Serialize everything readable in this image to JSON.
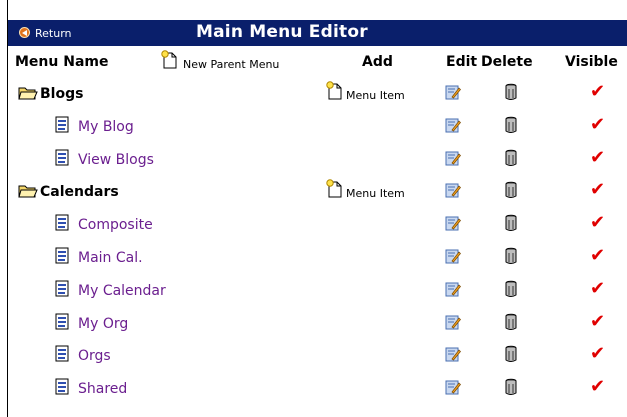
{
  "titlebar": {
    "return_label": "Return",
    "title": "Main Menu Editor"
  },
  "header": {
    "menu_name": "Menu Name",
    "new_parent": "New Parent Menu",
    "add": "Add",
    "edit": "Edit",
    "delete": "Delete",
    "visible": "Visible"
  },
  "rows": [
    {
      "name": "Blogs",
      "level": "parent",
      "add": "Menu Item",
      "visible": "✔"
    },
    {
      "name": "My Blog",
      "level": "child",
      "add": "",
      "visible": "✔"
    },
    {
      "name": "View Blogs",
      "level": "child",
      "add": "",
      "visible": "✔"
    },
    {
      "name": "Calendars",
      "level": "parent",
      "add": "Menu Item",
      "visible": "✔"
    },
    {
      "name": "Composite",
      "level": "child",
      "add": "",
      "visible": "✔"
    },
    {
      "name": "Main Cal.",
      "level": "child",
      "add": "",
      "visible": "✔"
    },
    {
      "name": "My Calendar",
      "level": "child",
      "add": "",
      "visible": "✔"
    },
    {
      "name": "My Org",
      "level": "child",
      "add": "",
      "visible": "✔"
    },
    {
      "name": "Orgs",
      "level": "child",
      "add": "",
      "visible": "✔"
    },
    {
      "name": "Shared",
      "level": "child",
      "add": "",
      "visible": "✔"
    }
  ],
  "colors": {
    "titlebar": "#0a1f6b",
    "child_link": "#6b1f8f",
    "check": "#e00000"
  },
  "icons": {
    "folder": "folder-open-icon",
    "doc": "document-icon",
    "new": "new-document-icon",
    "edit": "edit-icon",
    "delete": "trash-can-icon",
    "return": "back-arrow-icon"
  }
}
